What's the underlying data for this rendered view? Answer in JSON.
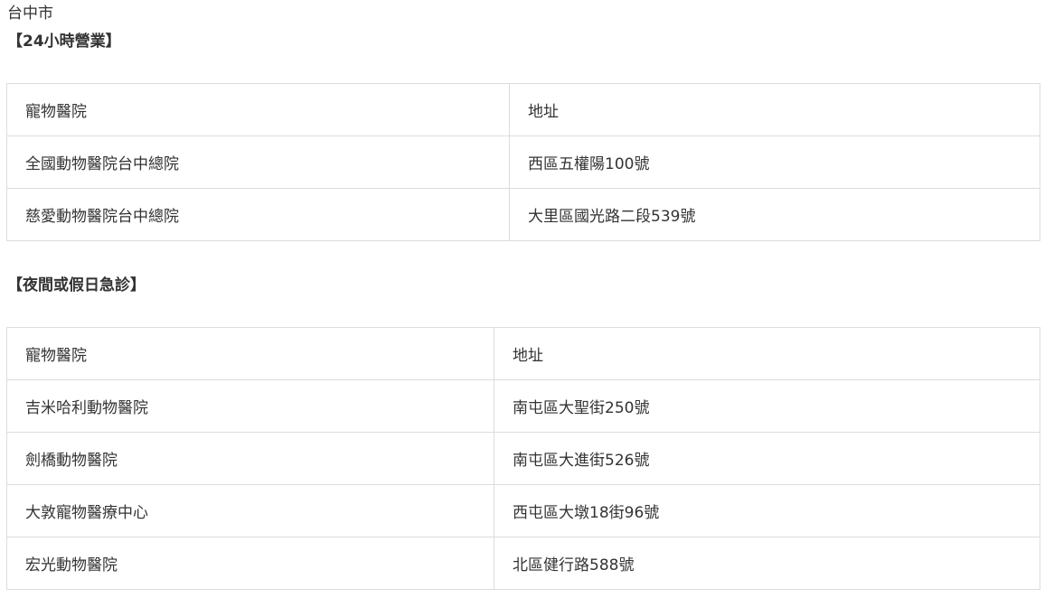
{
  "city": "台中市",
  "section_24h": {
    "title": "【24小時營業】",
    "headers": {
      "hospital": "寵物醫院",
      "address": "地址"
    },
    "rows": [
      {
        "hospital": "全國動物醫院台中總院",
        "address": "西區五權陽100號"
      },
      {
        "hospital": "慈愛動物醫院台中總院",
        "address": "大里區國光路二段539號"
      }
    ]
  },
  "section_night": {
    "title": "【夜間或假日急診】",
    "headers": {
      "hospital": "寵物醫院",
      "address": "地址"
    },
    "rows": [
      {
        "hospital": "吉米哈利動物醫院",
        "address": "南屯區大聖街250號"
      },
      {
        "hospital": "劍橋動物醫院",
        "address": "南屯區大進街526號"
      },
      {
        "hospital": "大敦寵物醫療中心",
        "address": "西屯區大墩18街96號"
      },
      {
        "hospital": "宏光動物醫院",
        "address": "北區健行路588號"
      }
    ]
  }
}
